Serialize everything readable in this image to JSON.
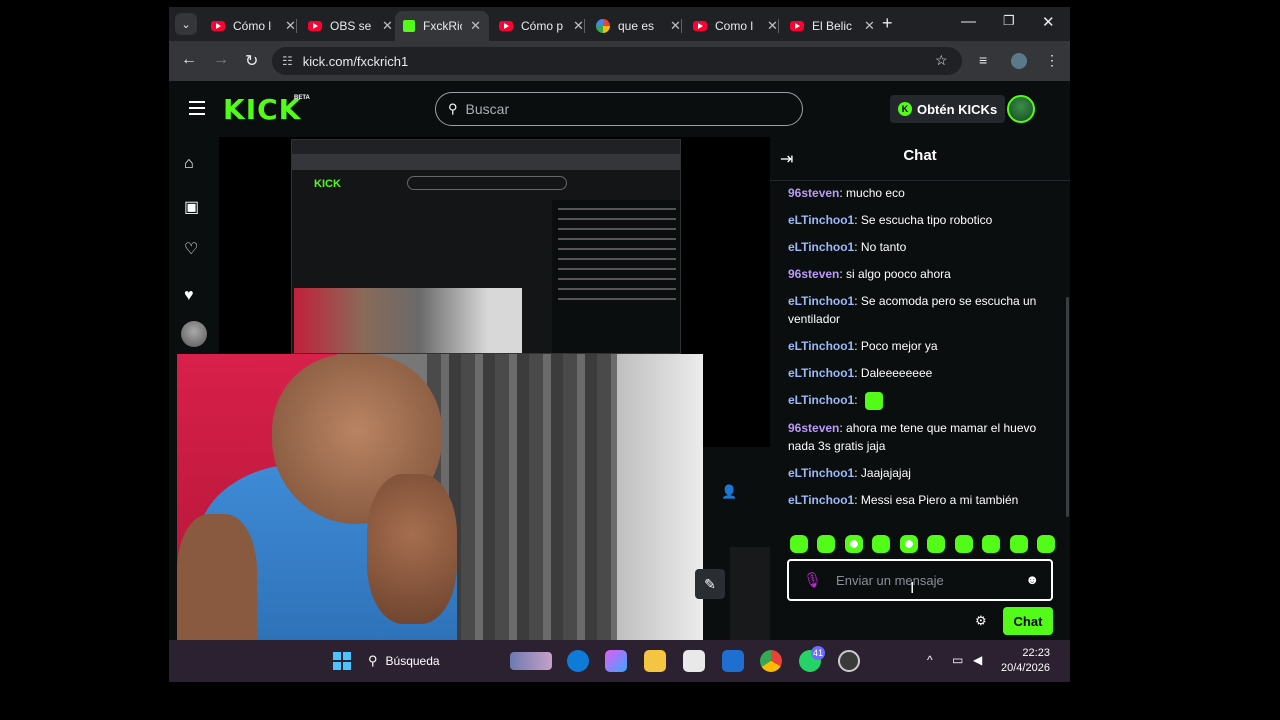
{
  "browser": {
    "tabs": [
      {
        "label": "Cómo l",
        "icon": "youtube-icon"
      },
      {
        "label": "OBS se",
        "icon": "youtube-icon"
      },
      {
        "label": "FxckRic",
        "icon": "kick-icon",
        "active": true
      },
      {
        "label": "Cómo p",
        "icon": "youtube-icon"
      },
      {
        "label": "que es",
        "icon": "google-icon"
      },
      {
        "label": "Como l",
        "icon": "youtube-icon"
      },
      {
        "label": "El Belic",
        "icon": "youtube-icon"
      }
    ],
    "url": "kick.com/fxckrich1"
  },
  "kick": {
    "logo": "KICK",
    "logo_badge": "BETA",
    "search_placeholder": "Buscar",
    "kicks_button": "Obtén KICKs",
    "nested_logo": "KICK"
  },
  "chat": {
    "title": "Chat",
    "messages": [
      {
        "user": "96steven",
        "user_color": "#b99bf7",
        "text": "mucho eco"
      },
      {
        "user": "eLTinchoo1",
        "user_color": "#9bb8f7",
        "text": "Se escucha tipo robotico"
      },
      {
        "user": "eLTinchoo1",
        "user_color": "#9bb8f7",
        "text": "No tanto"
      },
      {
        "user": "96steven",
        "user_color": "#b99bf7",
        "text": "si algo pooco ahora"
      },
      {
        "user": "eLTinchoo1",
        "user_color": "#9bb8f7",
        "text": "Se acomoda pero se escucha un ventilador"
      },
      {
        "user": "eLTinchoo1",
        "user_color": "#9bb8f7",
        "text": "Poco mejor ya"
      },
      {
        "user": "eLTinchoo1",
        "user_color": "#9bb8f7",
        "text": "Daleeeeeeee"
      },
      {
        "user": "eLTinchoo1",
        "user_color": "#9bb8f7",
        "text": "",
        "emote": true
      },
      {
        "user": "96steven",
        "user_color": "#b99bf7",
        "text": "ahora me tene que mamar el huevo nada 3s gratis jaja"
      },
      {
        "user": "eLTinchoo1",
        "user_color": "#9bb8f7",
        "text": "Jaajajajaj"
      },
      {
        "user": "eLTinchoo1",
        "user_color": "#9bb8f7",
        "text": "Messi esa Piero a mi también"
      }
    ],
    "input_placeholder": "Enviar un mensaje",
    "send_label": "Chat"
  },
  "taskbar": {
    "search_label": "Búsqueda",
    "whatsapp_badge": "41",
    "time": "22:23",
    "date": "20/4/2026"
  },
  "colors": {
    "kick_green": "#53fc18",
    "background": "#0b0e0f"
  }
}
